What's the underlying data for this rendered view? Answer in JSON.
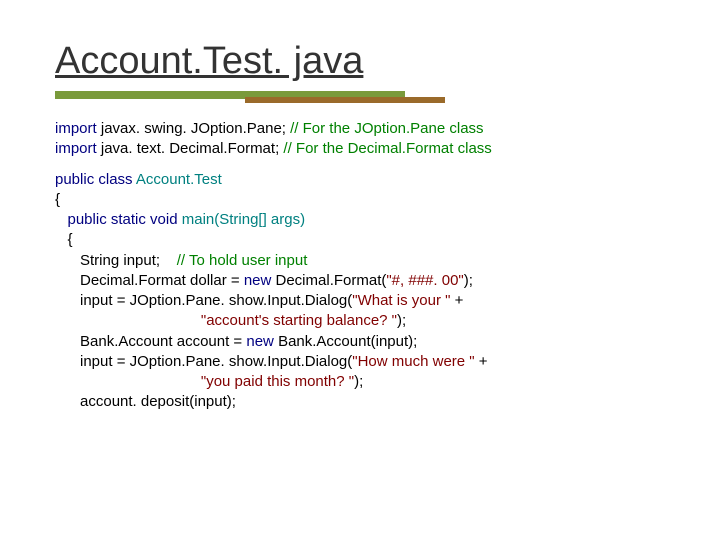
{
  "title": "Account.Test. java",
  "line1_a": "import",
  "line1_b": " javax. swing. JOption.Pane; ",
  "line1_c": "// For the JOption.Pane class",
  "line2_a": "import",
  "line2_b": " java. text. Decimal.Format; ",
  "line2_c": "// For the Decimal.Format class",
  "line3_a": "public class ",
  "line3_b": "Account.Test",
  "line4": "{",
  "line5_a": "   public static void ",
  "line5_b": "main(String[] args)",
  "line6": "   {",
  "line7_a": "      String input;    ",
  "line7_b": "// To hold user input",
  "line8_a": "      Decimal.Format dollar = ",
  "line8_b": "new",
  "line8_c": " Decimal.Format(",
  "line8_d": "\"#, ###. 00\"",
  "line8_e": ");",
  "line9_a": "      input = JOption.Pane. show.Input.Dialog(",
  "line9_b": "\"What is your \"",
  "line9_c": " +",
  "line10_a": "                                   ",
  "line10_b": "\"account's starting balance? \"",
  "line10_c": ");",
  "line11_a": "      Bank.Account account = ",
  "line11_b": "new",
  "line11_c": " Bank.Account(input);",
  "line12_a": "      input = JOption.Pane. show.Input.Dialog(",
  "line12_b": "\"How much were \"",
  "line12_c": " +",
  "line13_a": "                                   ",
  "line13_b": "\"you paid this month? \"",
  "line13_c": ");",
  "line14": "      account. deposit(input);"
}
